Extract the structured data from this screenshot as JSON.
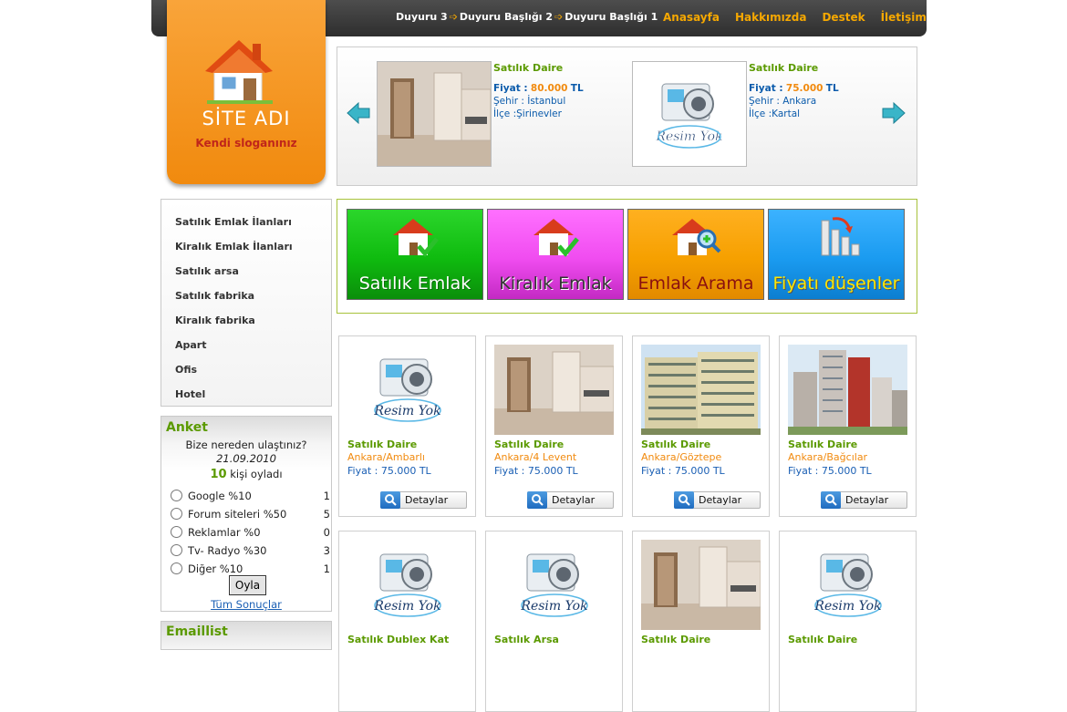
{
  "header": {
    "news": [
      "Duyuru 3",
      "Duyuru Başlığı 2",
      "Duyuru Başlığı 1"
    ],
    "nav": [
      "Anasayfa",
      "Hakkımızda",
      "Destek",
      "İletişim"
    ]
  },
  "logo": {
    "title": "SİTE ADI",
    "slogan": "Kendi sloganınız"
  },
  "slider": {
    "items": [
      {
        "title": "Satılık Daire",
        "price_label": "Fiyat :",
        "price": "80.000",
        "currency": "TL",
        "city": "Şehir : İstanbul",
        "district": "İlçe :Şirinevler",
        "image": "kitchen-photo"
      },
      {
        "title": "Satılık Daire",
        "price_label": "Fiyat :",
        "price": "75.000",
        "currency": "TL",
        "city": "Şehir : Ankara",
        "district": "İlçe :Kartal",
        "image": "no-image-placeholder"
      }
    ]
  },
  "menu": [
    "Satılık Emlak İlanları",
    "Kiralık Emlak İlanları",
    "Satılık arsa",
    "Satılık fabrika",
    "Kiralık fabrika",
    "Apart",
    "Ofis",
    "Hotel"
  ],
  "poll": {
    "title": "Anket",
    "question": "Bize nereden ulaştınız?",
    "date": "21.09.2010",
    "votes": "10",
    "votes_suffix": " kişi oyladı",
    "options": [
      {
        "label": "Google %10",
        "count": "1"
      },
      {
        "label": "Forum siteleri %50",
        "count": "5"
      },
      {
        "label": "Reklamlar %0",
        "count": "0"
      },
      {
        "label": "Tv- Radyo %30",
        "count": "3"
      },
      {
        "label": "Diğer %10",
        "count": "1"
      }
    ],
    "vote_button": "Oyla",
    "all_results": "Tüm Sonuçlar"
  },
  "emaillist": {
    "title": "Emaillist"
  },
  "categories": [
    {
      "label": "Satılık Emlak",
      "color": "#11c011"
    },
    {
      "label": "Kiralık Emlak",
      "color": "#f24ff2"
    },
    {
      "label": "Emlak Arama",
      "color": "#f6a000"
    },
    {
      "label": "Fiyatı düşenler",
      "color": "#1a9bf0"
    }
  ],
  "listings": [
    {
      "title": "Satılık Daire",
      "location": "Ankara/Ambarlı",
      "price": "Fiyat : 75.000 TL",
      "image": "no-image-placeholder"
    },
    {
      "title": "Satılık Daire",
      "location": "Ankara/4 Levent",
      "price": "Fiyat : 75.000 TL",
      "image": "kitchen-photo"
    },
    {
      "title": "Satılık Daire",
      "location": "Ankara/Göztepe",
      "price": "Fiyat : 75.000 TL",
      "image": "apartment-building-photo"
    },
    {
      "title": "Satılık Daire",
      "location": "Ankara/Bağcılar",
      "price": "Fiyat : 75.000 TL",
      "image": "tower-block-photo"
    },
    {
      "title": "Satılık Dublex Kat",
      "location": "",
      "price": "",
      "image": "no-image-placeholder"
    },
    {
      "title": "Satılık Arsa",
      "location": "",
      "price": "",
      "image": "no-image-placeholder"
    },
    {
      "title": "Satılık Daire",
      "location": "",
      "price": "",
      "image": "kitchen-photo"
    },
    {
      "title": "Satılık Daire",
      "location": "",
      "price": "",
      "image": "no-image-placeholder"
    }
  ],
  "detail_button": "Detaylar"
}
